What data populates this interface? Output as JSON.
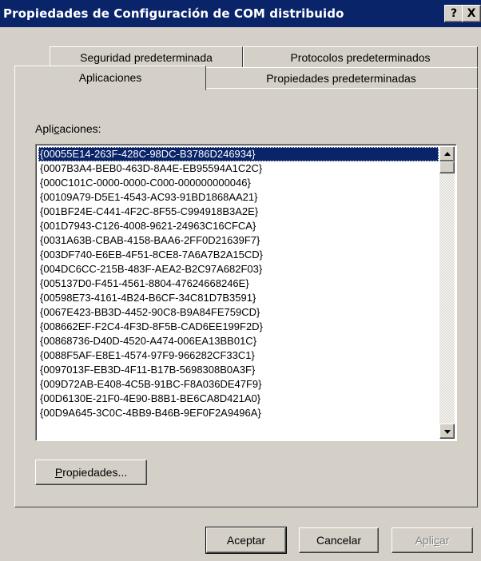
{
  "window": {
    "title": "Propiedades de Configuración de COM distribuido",
    "help_button": "?",
    "close_button": "X"
  },
  "tabs": {
    "row_top": [
      "Seguridad predeterminada",
      "Protocolos predeterminados"
    ],
    "row_bottom": [
      "Aplicaciones",
      "Propiedades predeterminadas"
    ],
    "active": "Aplicaciones"
  },
  "applications": {
    "label_prefix": "Apli",
    "label_accel": "c",
    "label_suffix": "aciones:",
    "selected_index": 0,
    "items": [
      "{00055E14-263F-428C-98DC-B3786D246934}",
      "{0007B3A4-BEB0-463D-8A4E-EB95594A1C2C}",
      "{000C101C-0000-0000-C000-000000000046}",
      "{00109A79-D5E1-4543-AC93-91BD1868AA21}",
      "{001BF24E-C441-4F2C-8F55-C994918B3A2E}",
      "{001D7943-C126-4008-9621-24963C16CFCA}",
      "{0031A63B-CBAB-4158-BAA6-2FF0D21639F7}",
      "{003DF740-E6EB-4F51-8CE8-7A6A7B2A15CD}",
      "{004DC6CC-215B-483F-AEA2-B2C97A682F03}",
      "{005137D0-F451-4561-8804-47624668246E}",
      "{00598E73-4161-4B24-B6CF-34C81D7B3591}",
      "{0067E423-BB3D-4452-90C8-B9A84FE759CD}",
      "{008662EF-F2C4-4F3D-8F5B-CAD6EE199F2D}",
      "{00868736-D40D-4520-A474-006EA13BB01C}",
      "{0088F5AF-E8E1-4574-97F9-966282CF33C1}",
      "{0097013F-EB3D-4F11-B17B-5698308B0A3F}",
      "{009D72AB-E408-4C5B-91BC-F8A036DE47F9}",
      "{00D6130E-21F0-4E90-B8B1-BE6CA8D421A0}",
      "{00D9A645-3C0C-4BB9-B46B-9EF0F2A9496A}"
    ]
  },
  "buttons": {
    "properties_prefix": "",
    "properties_accel": "P",
    "properties_suffix": "ropiedades...",
    "ok": "Aceptar",
    "cancel": "Cancelar",
    "apply_prefix": "Apli",
    "apply_accel": "c",
    "apply_suffix": "ar"
  }
}
